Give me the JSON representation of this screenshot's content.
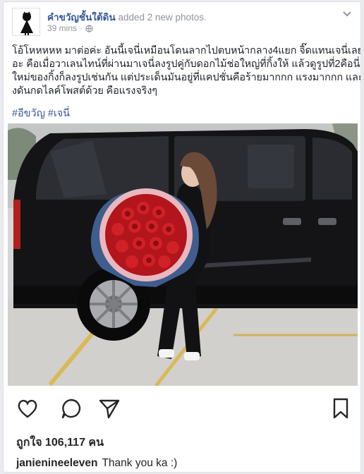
{
  "post": {
    "author": "คำขวัญชั้นใต้ดิน",
    "action": "added 2 new photos.",
    "time": "39 mins",
    "separator": "·",
    "text_lines": [
      "โอ้โหหหหห มาต่อค่ะ อันนี้เจนี่เหมือนโดนลากไปตบหน้ากลาง4แยก จิ๊ดแทนเจนี่เลย",
      "อะ คือเมื่อวาเลนไทน์ที่ผ่านมาเจนี่ลงรูปคู่กับดอกไม้ช่อใหญ่ที่กิ้งให้ แล้วดูรูปที่2คือนี่",
      "ใหม่ของกิ้งก็ลงรูปเช่นกัน แต่ประเด็นมันอยู่ที่แคปชั่นคือร้ายมากกก แรงมากกก และกิ้",
      "งดันกดไลค์โพสต์ด้วย คือแรงจริงๆ"
    ],
    "hashtags": [
      "#อีขวัญ",
      "#เจนี่"
    ]
  },
  "photo": {
    "icons": {
      "menu": "chevron-down-icon",
      "privacy": "globe-icon"
    }
  },
  "instagram": {
    "icons": [
      "heart-icon",
      "comment-icon",
      "share-icon",
      "bookmark-icon"
    ],
    "likes": "ถูกใจ 106,117 คน",
    "caption_user": "janienineeleven",
    "caption_text": "Thank you ka :)"
  },
  "colors": {
    "link": "#365899",
    "meta": "#90949c",
    "text": "#1d2129",
    "van": "#141416"
  }
}
